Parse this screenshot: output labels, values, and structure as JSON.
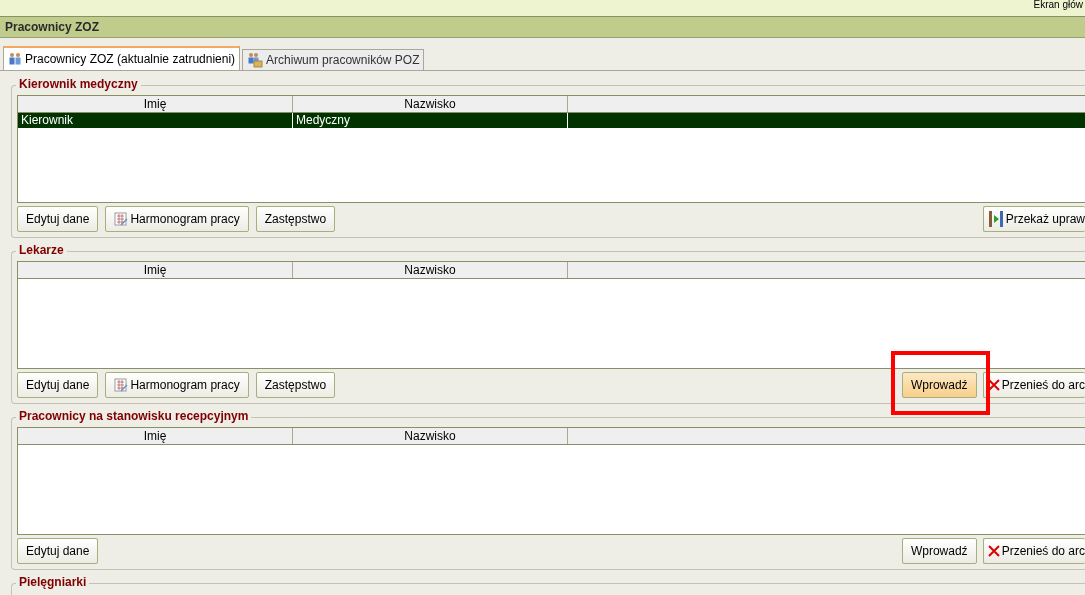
{
  "top_bar": {
    "text": "Ekran głów"
  },
  "window": {
    "title": "Pracownicy ZOZ"
  },
  "tabs": [
    {
      "label": "Pracownicy ZOZ (aktualnie zatrudnieni)",
      "selected": true
    },
    {
      "label": "Archiwum pracowników POZ",
      "selected": false
    }
  ],
  "sections": [
    {
      "title": "Kierownik medyczny",
      "columns": [
        "Imię",
        "Nazwisko"
      ],
      "rows": [
        {
          "cells": [
            "Kierownik",
            "Medyczny"
          ],
          "selected": true
        }
      ],
      "left_buttons": [
        {
          "label": "Edytuj dane",
          "kind": "plain",
          "highlighted": false
        },
        {
          "label": "Harmonogram pracy",
          "kind": "schedule",
          "highlighted": false
        },
        {
          "label": "Zastępstwo",
          "kind": "plain",
          "highlighted": false
        }
      ],
      "right_buttons": [
        {
          "label": "Przekaż upraw",
          "kind": "transfer",
          "highlighted": false
        }
      ]
    },
    {
      "title": "Lekarze",
      "columns": [
        "Imię",
        "Nazwisko"
      ],
      "left_buttons": [
        {
          "label": "Edytuj dane",
          "kind": "plain",
          "highlighted": false
        },
        {
          "label": "Harmonogram pracy",
          "kind": "schedule",
          "highlighted": false
        },
        {
          "label": "Zastępstwo",
          "kind": "plain",
          "highlighted": false
        }
      ],
      "right_buttons": [
        {
          "label": "Wprowadź",
          "kind": "plain",
          "highlighted": true
        },
        {
          "label": "Przenieś do arc",
          "kind": "archive",
          "highlighted": false
        }
      ]
    },
    {
      "title": "Pracownicy na stanowisku recepcyjnym",
      "columns": [
        "Imię",
        "Nazwisko"
      ],
      "left_buttons": [
        {
          "label": "Edytuj dane",
          "kind": "plain",
          "highlighted": false
        }
      ],
      "right_buttons": [
        {
          "label": "Wprowadź",
          "kind": "plain",
          "highlighted": false
        },
        {
          "label": "Przenieś do arc",
          "kind": "archive",
          "highlighted": false
        }
      ]
    },
    {
      "title": "Pielęgniarki"
    }
  ]
}
